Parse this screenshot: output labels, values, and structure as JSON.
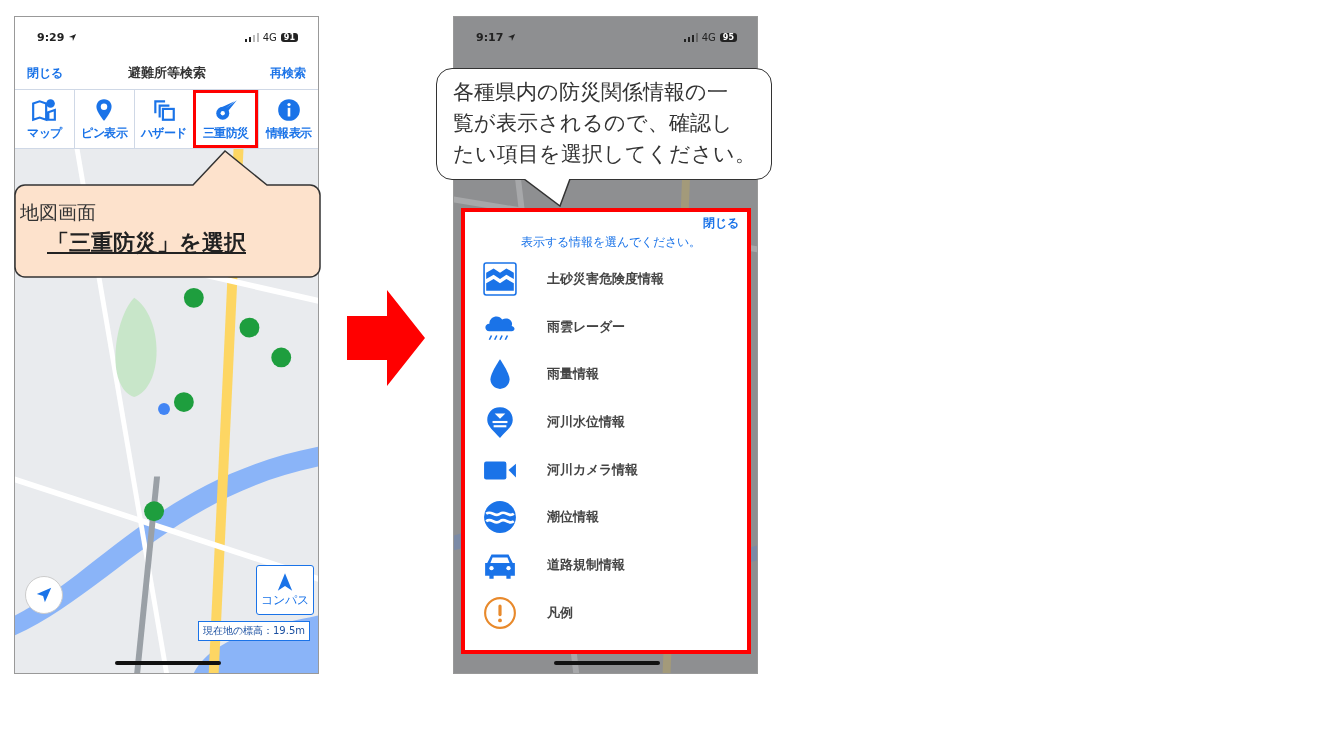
{
  "phone_1": {
    "status_bar": {
      "time": "9:29",
      "network": "4G",
      "battery": "91"
    },
    "nav_bar": {
      "left": "閉じる",
      "title": "避難所等検索",
      "right": "再検索"
    },
    "tabs": [
      {
        "label": "マップ",
        "kind": "map",
        "highlighted": false
      },
      {
        "label": "ピン表示",
        "kind": "pin",
        "highlighted": false
      },
      {
        "label": "ハザード",
        "kind": "layers",
        "highlighted": false
      },
      {
        "label": "三重防災",
        "kind": "comet",
        "highlighted": true
      },
      {
        "label": "情報表示",
        "kind": "info",
        "highlighted": false
      }
    ],
    "map": {
      "compass_label": "コンパス",
      "elevation": "現在地の標高：19.5m"
    }
  },
  "callout_1": {
    "line_1": "地図画面",
    "line_2": "「三重防災」を選択"
  },
  "phone_2": {
    "status_bar": {
      "time": "9:17",
      "network": "4G",
      "battery": "95"
    },
    "sheet": {
      "highlighted": true,
      "close": "閉じる",
      "prompt": "表示する情報を選んでください。",
      "items": [
        {
          "label": "土砂災害危険度情報",
          "kind": "landslide"
        },
        {
          "label": "雨雲レーダー",
          "kind": "rain"
        },
        {
          "label": "雨量情報",
          "kind": "drop"
        },
        {
          "label": "河川水位情報",
          "kind": "river"
        },
        {
          "label": "河川カメラ情報",
          "kind": "camera"
        },
        {
          "label": "潮位情報",
          "kind": "tide"
        },
        {
          "label": "道路規制情報",
          "kind": "car"
        },
        {
          "label": "凡例",
          "kind": "legend"
        }
      ]
    }
  },
  "callout_2": {
    "text": "各種県内の防災関係情報の一覧が表示されるので、確認したい項目を選択してください。"
  }
}
